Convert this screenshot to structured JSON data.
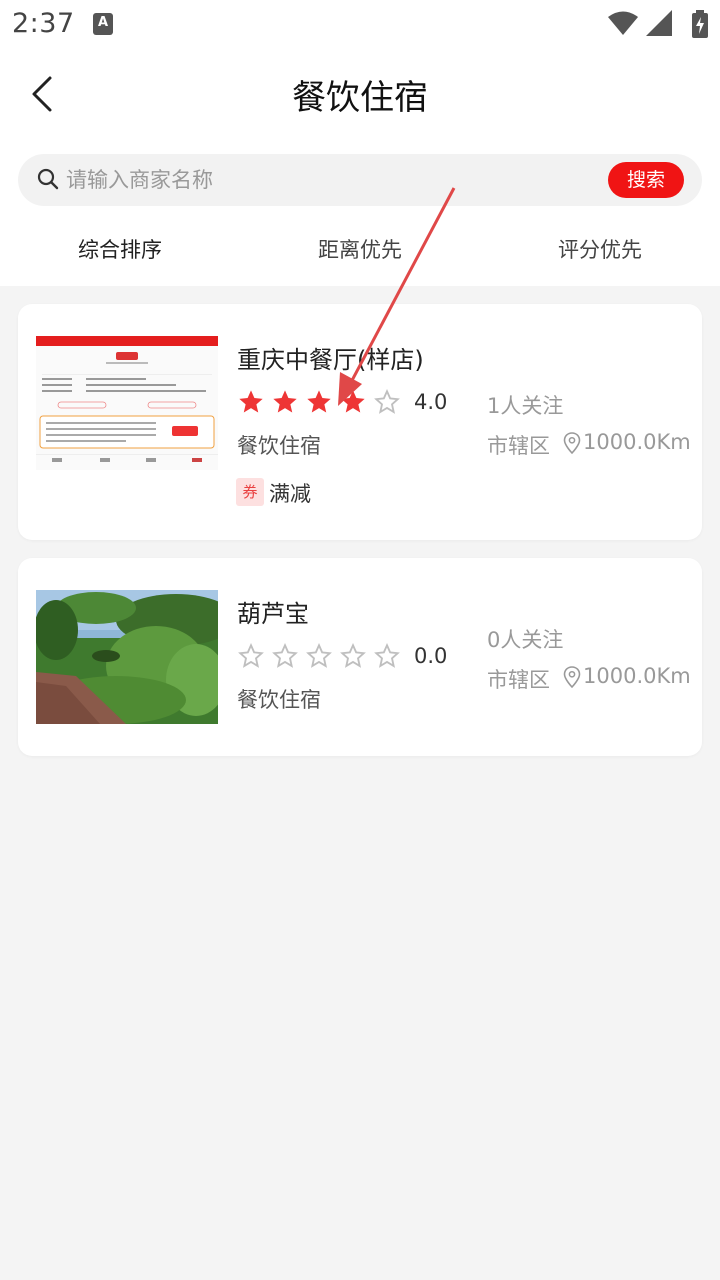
{
  "status_bar": {
    "time": "2:37",
    "app_icon_letter": "A",
    "icons": [
      "wifi-icon",
      "signal-icon",
      "battery-icon"
    ]
  },
  "header": {
    "title": "餐饮住宿",
    "back_icon": "chevron-left-icon"
  },
  "search": {
    "placeholder": "请输入商家名称",
    "value": "",
    "button_label": "搜索"
  },
  "tabs": [
    "综合排序",
    "距离优先",
    "评分优先"
  ],
  "colors": {
    "accent": "#f01414",
    "star_filled": "#ee3535",
    "star_empty": "#bfbfbf"
  },
  "shops": [
    {
      "name": "重庆中餐厅(样店)",
      "rating": "4.0",
      "stars_filled": 4,
      "category": "餐饮住宿",
      "followers": "1人关注",
      "district": "市辖区",
      "distance": "1000.0Km",
      "coupon_badge": "券",
      "coupon_text": "满减"
    },
    {
      "name": "葫芦宝",
      "rating": "0.0",
      "stars_filled": 0,
      "category": "餐饮住宿",
      "followers": "0人关注",
      "district": "市辖区",
      "distance": "1000.0Km"
    }
  ]
}
